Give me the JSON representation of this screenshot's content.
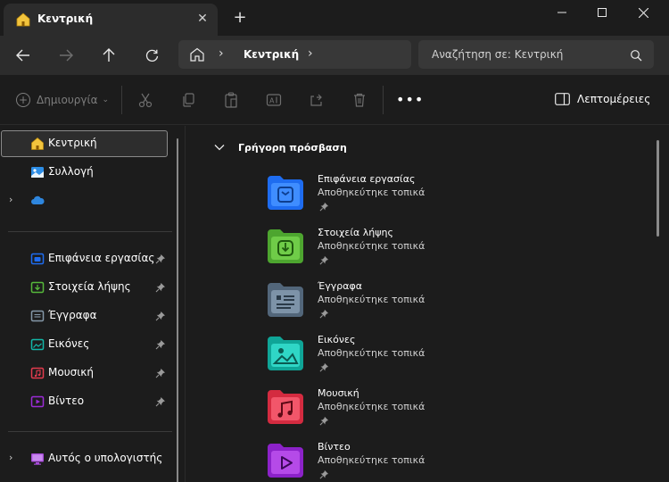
{
  "window": {
    "tab_title": "Κεντρική",
    "tab_close": "✕",
    "new_tab": "+"
  },
  "nav": {
    "breadcrumb": "Κεντρική",
    "separator": "›",
    "search_placeholder": "Αναζήτηση σε: Κεντρική"
  },
  "toolbar": {
    "new_label": "Δημιουργία",
    "new_chevron": "⌄",
    "more": "•••",
    "details_label": "Λεπτομέρειες"
  },
  "sidebar": {
    "home": "Κεντρική",
    "gallery": "Συλλογή",
    "onedrive_expand": "›",
    "pinned": [
      {
        "label": "Επιφάνεια εργασίας",
        "color": "#1e6cf0"
      },
      {
        "label": "Στοιχεία λήψης",
        "color": "#56b83a"
      },
      {
        "label": "Έγγραφα",
        "color": "#5b6f80"
      },
      {
        "label": "Εικόνες",
        "color": "#12b7a8"
      },
      {
        "label": "Μουσική",
        "color": "#e23b4e"
      },
      {
        "label": "Βίντεο",
        "color": "#9b2bd6"
      }
    ],
    "this_pc": "Αυτός ο υπολογιστής",
    "this_pc_expand": "›"
  },
  "main": {
    "section_title": "Γρήγορη πρόσβαση",
    "items": [
      {
        "name": "Επιφάνεια εργασίας",
        "status": "Αποθηκεύτηκε τοπικά",
        "icon": "desktop-folder-icon",
        "color": "#1e6cf0"
      },
      {
        "name": "Στοιχεία λήψης",
        "status": "Αποθηκεύτηκε τοπικά",
        "icon": "downloads-folder-icon",
        "color": "#56b83a"
      },
      {
        "name": "Έγγραφα",
        "status": "Αποθηκεύτηκε τοπικά",
        "icon": "documents-folder-icon",
        "color": "#5b6f80"
      },
      {
        "name": "Εικόνες",
        "status": "Αποθηκεύτηκε τοπικά",
        "icon": "pictures-folder-icon",
        "color": "#12b7a8"
      },
      {
        "name": "Μουσική",
        "status": "Αποθηκεύτηκε τοπικά",
        "icon": "music-folder-icon",
        "color": "#e23b4e"
      },
      {
        "name": "Βίντεο",
        "status": "Αποθηκεύτηκε τοπικά",
        "icon": "videos-folder-icon",
        "color": "#9b2bd6"
      }
    ]
  }
}
